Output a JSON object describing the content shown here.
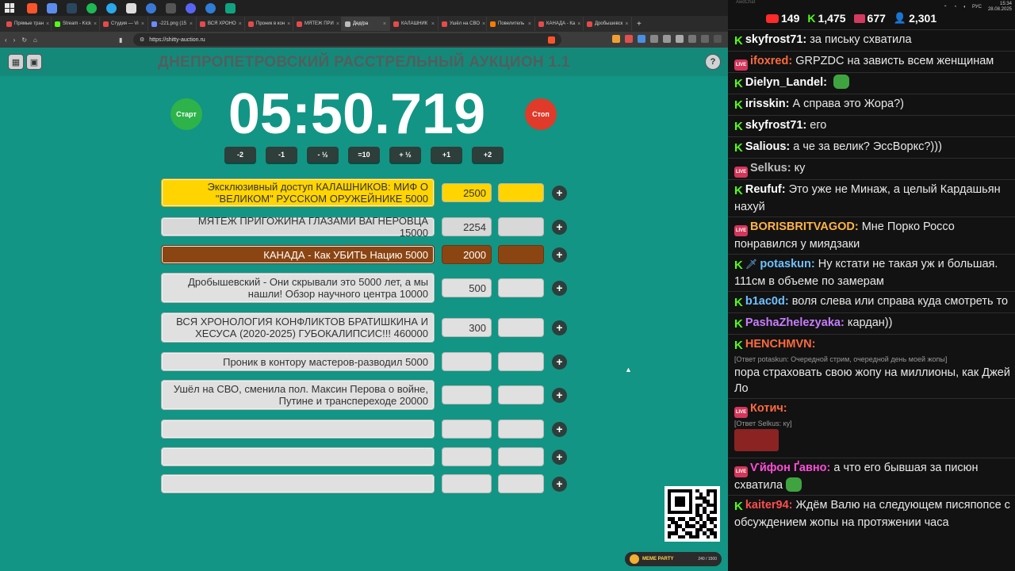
{
  "browser": {
    "tabs": [
      {
        "label": "Прямые тран",
        "color": "#e54a4a"
      },
      {
        "label": "Stream - Kick",
        "color": "#53fc18"
      },
      {
        "label": "Студия — Vi",
        "color": "#e54a4a"
      },
      {
        "label": "-221.png (15",
        "color": "#6b8cff"
      },
      {
        "label": "ВСЯ ХРОНО",
        "color": "#e54a4a"
      },
      {
        "label": "Проник в кон",
        "color": "#e54a4a"
      },
      {
        "label": "МЯТЕЖ ПРИ",
        "color": "#e54a4a"
      },
      {
        "label": "Дед/ра",
        "color": "#bbbbbb"
      },
      {
        "label": "КАЛАШНИК",
        "color": "#e54a4a"
      },
      {
        "label": "Ушёл на СВО",
        "color": "#e54a4a"
      },
      {
        "label": "Повелитель",
        "color": "#ff7a00"
      },
      {
        "label": "КАНАДА - Ка",
        "color": "#e54a4a"
      },
      {
        "label": "Дробышевск",
        "color": "#e54a4a"
      }
    ],
    "active_tab_index": 7,
    "url": "https://shitty-auction.ru"
  },
  "auction": {
    "title": "ДНЕПРОПЕТРОВСКИЙ РАССТРЕЛЬНЫЙ АУКЦИОН 1.1",
    "help": "?",
    "start_label": "Старт",
    "stop_label": "Стоп",
    "timer": "05:50.719",
    "adjust_buttons": [
      "-2",
      "-1",
      "- ½",
      "=10",
      "+ ½",
      "+1",
      "+2"
    ],
    "lots": [
      {
        "name": "Эксклюзивный доступ КАЛАШНИКОВ: МИФ О \"ВЕЛИКОМ\" РУССКОМ ОРУЖЕЙНИКЕ 5000",
        "amount": "2500",
        "color": "#ffd400"
      },
      {
        "name": "МЯТЕЖ ПРИГОЖИНА ГЛАЗАМИ ВАГНЕРОВЦА 15000",
        "amount": "2254",
        "color": "#d8d8d8"
      },
      {
        "name": "КАНАДА - Как УБИТЬ Нацию 5000",
        "amount": "2000",
        "color": "#8b4513"
      },
      {
        "name": "Дробышевский - Они скрывали это 5000 лет, а мы нашли! Обзор научного центра 10000",
        "amount": "500",
        "color": "#e0e0e0"
      },
      {
        "name": "ВСЯ ХРОНОЛОГИЯ КОНФЛИКТОВ БРАТИШКИНА И ХЕСУСА (2020-2025) ГУБОКАЛИПСИС!!! 460000",
        "amount": "300",
        "color": "#e0e0e0"
      },
      {
        "name": "Проник в контору мастеров-разводил 5000",
        "amount": "",
        "color": "#e0e0e0"
      },
      {
        "name": "Ушёл на СВО, сменила пол. Максин Перова о войне, Путине и транспереходе 20000",
        "amount": "",
        "color": "#e0e0e0"
      },
      {
        "name": "",
        "amount": "",
        "color": "#e0e0e0"
      },
      {
        "name": "",
        "amount": "",
        "color": "#e0e0e0"
      },
      {
        "name": "",
        "amount": "",
        "color": "#e0e0e0"
      }
    ],
    "plus_label": "+",
    "meme_label": "MEME PARTY",
    "meme_count": "240 / 1500"
  },
  "system": {
    "time": "15:34",
    "date": "28.08.2025",
    "lang": "РУС"
  },
  "chat": {
    "app_name": "AwdChat",
    "counters": {
      "youtube": "149",
      "kick": "1,475",
      "vk": "677",
      "viewers": "2,301"
    },
    "messages": [
      {
        "platform": "kick",
        "nick": "skyfrost71",
        "color": "#ffffff",
        "text": "за письку схватила"
      },
      {
        "platform": "live",
        "nick": "ifoxred",
        "color": "#ff6a3d",
        "text": "GRPZDC на зависть всем женщинам"
      },
      {
        "platform": "kick",
        "nick": "Dielyn_Landel",
        "color": "#ffffff",
        "text": "",
        "emote": true
      },
      {
        "platform": "kick",
        "nick": "irisskin",
        "color": "#ffffff",
        "text": "А справа это Жора?)"
      },
      {
        "platform": "kick",
        "nick": "skyfrost71",
        "color": "#ffffff",
        "text": "его"
      },
      {
        "platform": "kick",
        "nick": "Salious",
        "color": "#ffffff",
        "text": "а че за велик? ЭссВоркс?)))"
      },
      {
        "platform": "live",
        "nick": "Selkus",
        "color": "#bdbdbd",
        "text": "ку"
      },
      {
        "platform": "kick",
        "nick": "Reufuf",
        "color": "#ffffff",
        "text": "Это уже не Минаж, а целый Кардашьян нахуй"
      },
      {
        "platform": "live",
        "nick": "BORISBRITVAGOD",
        "color": "#ffb347",
        "text": "Мне Порко Россо понравился у миядзаки"
      },
      {
        "platform": "kick",
        "nick": "potaskun",
        "color": "#6ec1ff",
        "text": "Ну кстати не такая уж и большая. 111см в объеме по замерам",
        "sword": true
      },
      {
        "platform": "kick",
        "nick": "b1ac0d",
        "color": "#6ec1ff",
        "text": "воля слева или справа куда смотреть то"
      },
      {
        "platform": "kick",
        "nick": "PashaZhelezyaka",
        "color": "#c77dff",
        "text": "кардан))"
      },
      {
        "platform": "kick",
        "nick": "HENCHMVN",
        "color": "#ff6a3d",
        "reply": "[Ответ potaskun: Очередной стрим, очередной день моей жопы]",
        "text": "пора страховать свою жопу на миллионы, как Джей Ло"
      },
      {
        "platform": "live",
        "nick": "Котич",
        "color": "#ff6a3d",
        "reply": "[Ответ Selkus: ку]",
        "text": "",
        "cat": true
      },
      {
        "platform": "live",
        "nick": "Ѵйфон Ґавно",
        "color": "#ff4dd8",
        "text": "а что его бывшая за писюн схватила",
        "emote_after": true
      },
      {
        "platform": "kick",
        "nick": "kaiter94",
        "color": "#ff4d4d",
        "text": "Ждём Валю на следующем писяпопсе с обсуждением жопы на протяжении часа"
      }
    ]
  }
}
